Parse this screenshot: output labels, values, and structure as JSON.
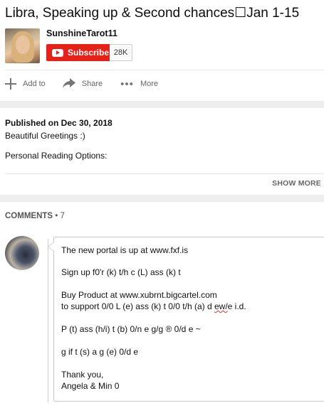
{
  "video": {
    "title": "Libra, Speaking up & Second chances☐Jan 1-15"
  },
  "channel": {
    "name": "SunshineTarot11",
    "subscribe_label": "Subscribe",
    "subscriber_count": "28K"
  },
  "actions": [
    {
      "label": "Add to",
      "icon": "plus-icon"
    },
    {
      "label": "Share",
      "icon": "share-arrow-icon"
    },
    {
      "label": "More",
      "icon": "more-dots-icon"
    }
  ],
  "description": {
    "published": "Published on Dec 30, 2018",
    "line1": "Beautiful Greetings :)",
    "line2": "Personal Reading Options:",
    "show_more": "SHOW MORE"
  },
  "comments": {
    "heading": "COMMENTS",
    "count": "• 7",
    "first": {
      "lines": [
        "The new portal is up at www.fxf.is",
        "Sign up f0'r (k) t/h c (L) ass (k) t",
        "Buy Product at www.xubrnt.bigcartel.com",
        "to support 0/0 L (e) ass (k) t 0/0 t/h (a) d ",
        "ew/",
        "e i.d.",
        "P (t) ass (h/i) t (b) 0/n e g/g ® 0/d e ~",
        "g if t (s) a g (e) 0/d e",
        "Thank you,",
        "Angela & Min 0"
      ]
    }
  },
  "colors": {
    "subscribe_red": "#e62117",
    "divider": "#e5e5e5",
    "band": "#eeeeee"
  }
}
